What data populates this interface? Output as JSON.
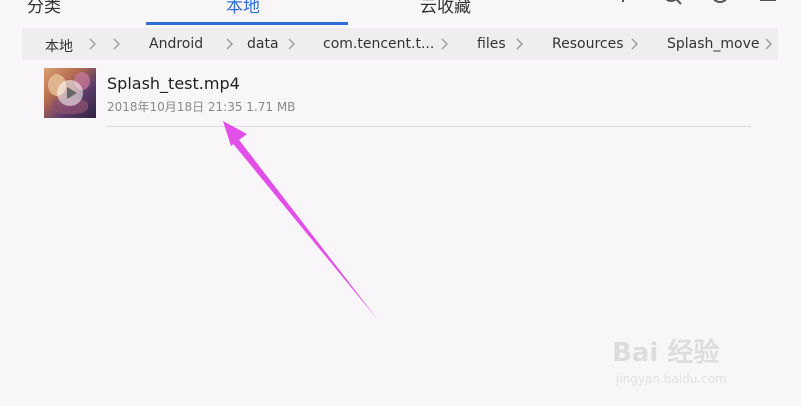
{
  "tabs": {
    "classify": "分类",
    "local": "本地",
    "cloud": "云收藏"
  },
  "colors": {
    "accent": "#2d6fd6",
    "annotation_arrow": "#e14ee8"
  },
  "toolbar": {
    "icons": [
      "add-icon",
      "search-icon",
      "refresh-icon",
      "menu-icon"
    ]
  },
  "breadcrumb": {
    "items": [
      "本地",
      "Android",
      "data",
      "com.tencent.t...",
      "files",
      "Resources",
      "Splash_move"
    ]
  },
  "file": {
    "name": "Splash_test.mp4",
    "meta": "2018年10月18日 21:35 1.71 MB"
  },
  "watermark": {
    "text": "Bai 经验",
    "url": "jingyan.baidu.com"
  }
}
